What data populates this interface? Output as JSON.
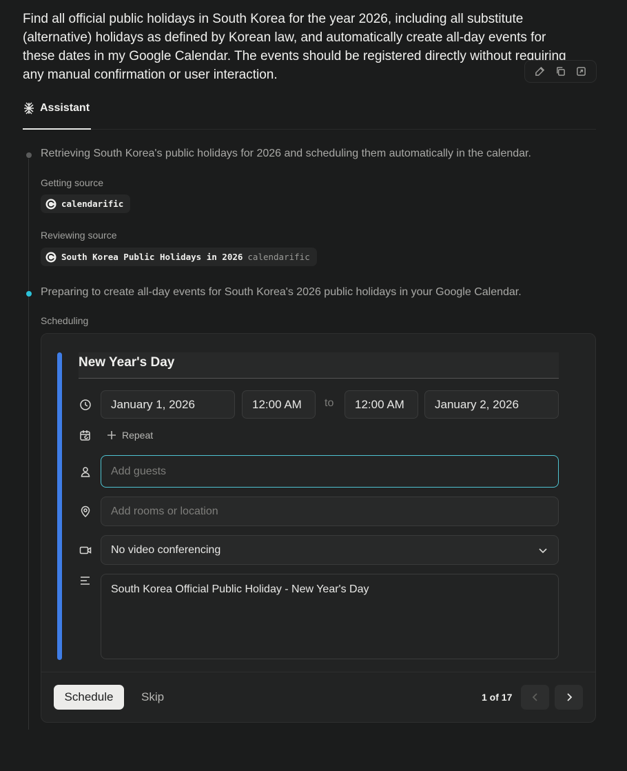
{
  "query": {
    "text": "Find all official public holidays in South Korea for the year 2026, including all substitute (alternative) holidays as defined by Korean law, and automatically create all-day events for these dates in my Google Calendar. The events should be registered directly without requiring any manual confirmation or user interaction.",
    "actions": [
      "edit-icon",
      "copy-icon",
      "share-icon"
    ]
  },
  "tabs": {
    "assistant_label": "Assistant"
  },
  "steps": [
    {
      "text": "Retrieving South Korea's public holidays for 2026 and scheduling them automatically in the calendar.",
      "actions": [
        {
          "label": "Getting source",
          "chip_title": "calendarific",
          "chip_source": ""
        },
        {
          "label": "Reviewing source",
          "chip_title": "South Korea Public Holidays in 2026",
          "chip_source": "calendarific"
        }
      ]
    },
    {
      "text": "Preparing to create all-day events for South Korea's 2026 public holidays in your Google Calendar.",
      "actions": [
        {
          "label": "Scheduling"
        }
      ]
    }
  ],
  "event": {
    "title": "New Year's Day",
    "start_date": "January 1, 2026",
    "start_time": "12:00 AM",
    "to_label": "to",
    "end_time": "12:00 AM",
    "end_date": "January 2, 2026",
    "repeat_label": "Repeat",
    "guests_placeholder": "Add guests",
    "location_placeholder": "Add rooms or location",
    "conferencing": "No video conferencing",
    "description": "South Korea Official Public Holiday - New Year's Day",
    "accent_color": "#3f7de6"
  },
  "footer": {
    "schedule_label": "Schedule",
    "skip_label": "Skip",
    "pager": "1 of 17"
  }
}
